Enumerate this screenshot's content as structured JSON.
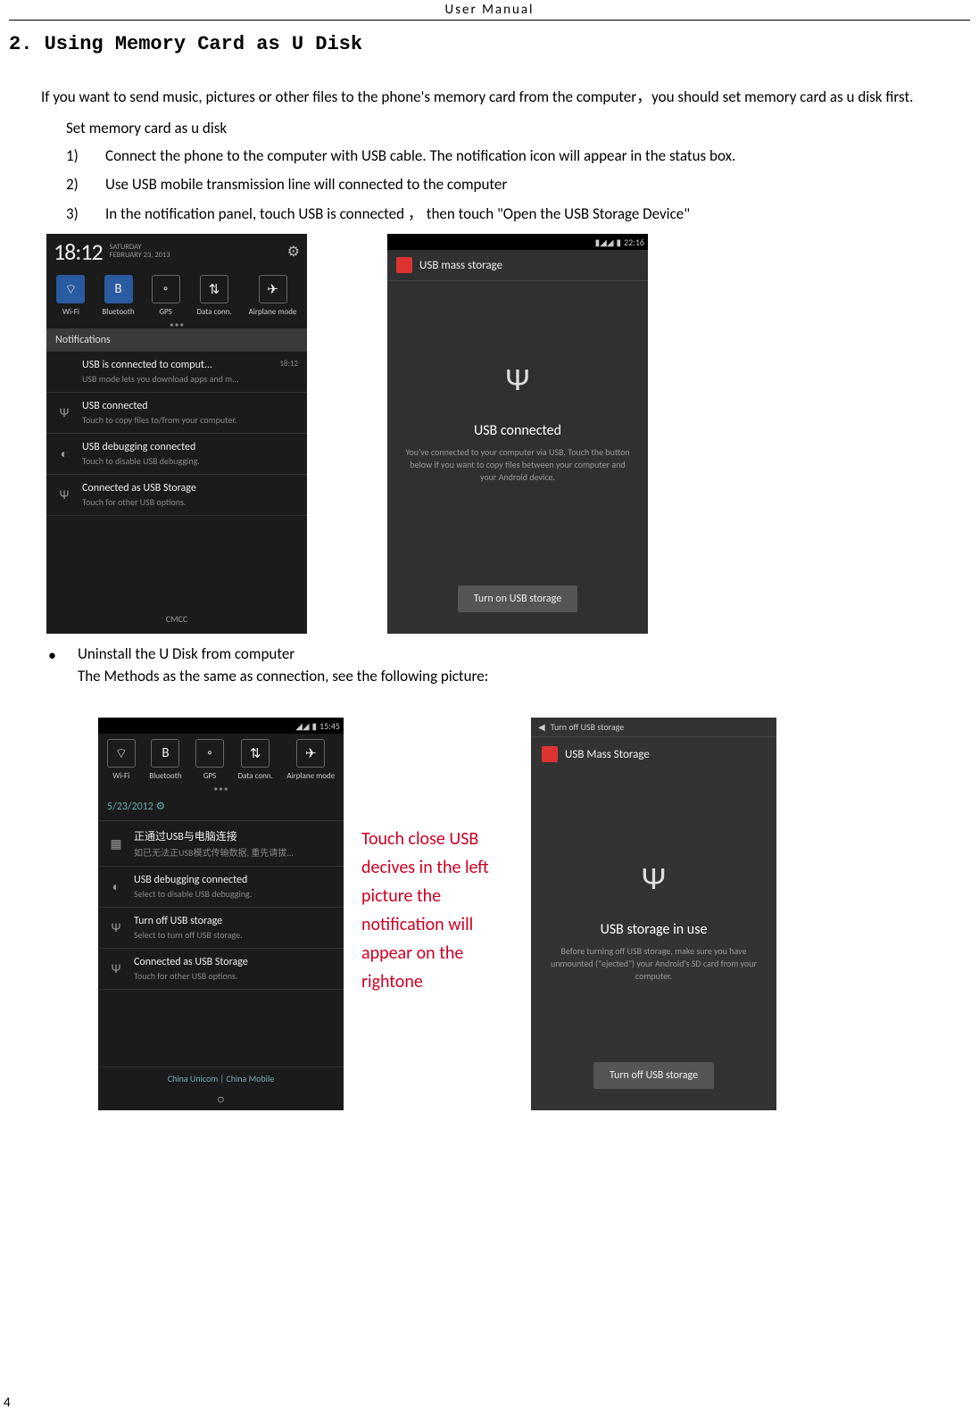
{
  "header": {
    "title": "User  Manual"
  },
  "section": {
    "heading": "2. Using Memory Card as U Disk"
  },
  "intro": "If you want to send music, pictures or other files to the phone's memory card from the computer，you should set memory card as u disk first.",
  "sub_heading": "Set memory card as u disk",
  "steps": [
    {
      "num": "1)",
      "text": "Connect the phone to the computer with USB cable. The notification icon will appear in the status box."
    },
    {
      "num": "2)",
      "text": "Use USB mobile transmission line will connected to the computer"
    },
    {
      "num": "3)",
      "text": "In the notification panel, touch USB is connected ， then touch \"Open the USB Storage Device\""
    }
  ],
  "phone1": {
    "time": "18:12",
    "weekday": "SATURDAY",
    "date": "FEBRUARY 23, 2013",
    "toggles": [
      {
        "label": "Wi-Fi",
        "icon": "⌔",
        "on": true
      },
      {
        "label": "Bluetooth",
        "icon": "B",
        "on": true
      },
      {
        "label": "GPS",
        "icon": "◦",
        "on": false
      },
      {
        "label": "Data conn.",
        "icon": "⇅",
        "on": false
      },
      {
        "label": "Airplane mode",
        "icon": "✈",
        "on": false
      }
    ],
    "notif_header": "Notifications",
    "notifs": [
      {
        "icon": "",
        "title": "USB is connected to comput...",
        "sub": "USB mode lets you download apps and m...",
        "time": "18:12"
      },
      {
        "icon": "Ψ",
        "title": "USB connected",
        "sub": "Touch to copy files to/from your computer."
      },
      {
        "icon": "◐",
        "title": "USB debugging connected",
        "sub": "Touch to disable USB debugging."
      },
      {
        "icon": "Ψ",
        "title": "Connected as USB Storage",
        "sub": "Touch for other USB options."
      }
    ],
    "carrier": "CMCC"
  },
  "phone2": {
    "status_time": "22:16",
    "header": "USB mass storage",
    "title": "USB connected",
    "desc": "You've connected to your computer via USB. Touch the button below if you want to copy files between your computer and your Android device.",
    "button": "Turn on USB storage"
  },
  "bullet": {
    "title": "Uninstall the U Disk from computer",
    "sub": "The Methods as the same as connection, see the following picture:"
  },
  "phone3": {
    "status_time": "15:45",
    "toggles": [
      {
        "label": "Wi-Fi"
      },
      {
        "label": "Bluetooth"
      },
      {
        "label": "GPS"
      },
      {
        "label": "Data conn."
      },
      {
        "label": "Airplane mode"
      }
    ],
    "date": "5/23/2012",
    "notifs": [
      {
        "icon": "▦",
        "title": "正通过USB与电脑连接",
        "sub": "如已无法正USB模式传输数据, 重先请拔..."
      },
      {
        "icon": "◐",
        "title": "USB debugging connected",
        "sub": "Select to disable USB debugging."
      },
      {
        "icon": "Ψ",
        "title": "Turn off USB storage",
        "sub": "Select to turn off USB storage."
      },
      {
        "icon": "Ψ",
        "title": "Connected as USB Storage",
        "sub": "Touch for other USB options."
      }
    ],
    "carrier": "China Unicom  |  China Mobile"
  },
  "touch_note": "Touch close USB decives in the left picture    the notification will appear on the rightone",
  "phone4": {
    "back": "Turn off USB storage",
    "header": "USB Mass Storage",
    "title": "USB storage in use",
    "desc": "Before turning off USB storage, make sure you have unmounted (\"ejected\") your Android's SD card from your computer.",
    "button": "Turn off USB storage"
  },
  "page_number": "4"
}
